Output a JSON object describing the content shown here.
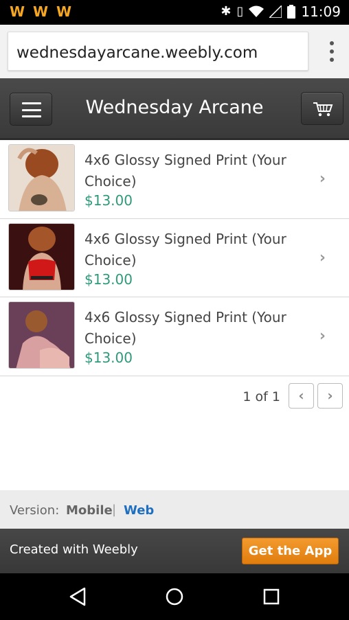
{
  "status_bar": {
    "time": "11:09",
    "notification_icons": [
      "W",
      "W",
      "W"
    ]
  },
  "browser": {
    "url": "wednesdayarcane.weebly.com"
  },
  "header": {
    "site_title": "Wednesday Arcane"
  },
  "products": [
    {
      "name": "4x6 Glossy Signed Print (Your Choice)",
      "price": "$13.00"
    },
    {
      "name": "4x6 Glossy Signed Print (Your Choice)",
      "price": "$13.00"
    },
    {
      "name": "4x6 Glossy Signed Print (Your Choice)",
      "price": "$13.00"
    }
  ],
  "pagination": {
    "label": "1 of 1",
    "prev": "‹",
    "next": "›"
  },
  "version": {
    "label": "Version:",
    "mobile": "Mobile",
    "separator": "|",
    "web": "Web"
  },
  "footer": {
    "created_with": "Created with Weebly",
    "get_app": "Get the App"
  },
  "colors": {
    "price": "#2e9a7a",
    "accent_orange": "#f39a2e",
    "link_blue": "#1f6fc1"
  }
}
